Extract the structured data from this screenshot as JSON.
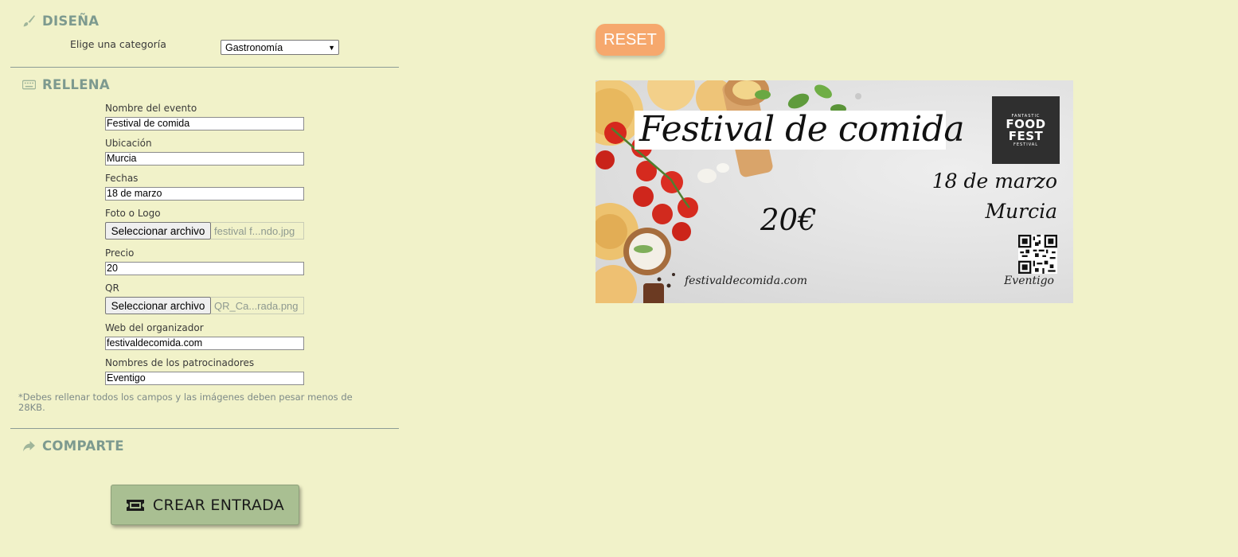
{
  "design": {
    "heading": "DISEÑA",
    "category_label": "Elige una categoría",
    "category_selected": "Gastronomía"
  },
  "fill": {
    "heading": "RELLENA",
    "fields": {
      "event_name": {
        "label": "Nombre del evento",
        "value": "Festival de comida"
      },
      "location": {
        "label": "Ubicación",
        "value": "Murcia"
      },
      "dates": {
        "label": "Fechas",
        "value": "18 de marzo"
      },
      "photo": {
        "label": "Foto o Logo",
        "button": "Seleccionar archivo",
        "filename": "festival f...ndo.jpg"
      },
      "price": {
        "label": "Precio",
        "value": "20"
      },
      "qr": {
        "label": "QR",
        "button": "Seleccionar archivo",
        "filename": "QR_Ca...rada.png"
      },
      "website": {
        "label": "Web del organizador",
        "value": "festivaldecomida.com"
      },
      "sponsors": {
        "label": "Nombres de los patrocinadores",
        "value": "Eventigo"
      }
    },
    "note": "*Debes rellenar todos los campos y las imágenes deben pesar menos de 28KB."
  },
  "share": {
    "heading": "COMPARTE",
    "create_button": "CREAR ENTRADA"
  },
  "preview": {
    "reset_label": "RESET",
    "ticket": {
      "title": "Festival de comida",
      "date": "18 de marzo",
      "location": "Murcia",
      "price": "20€",
      "website": "festivaldecomida.com",
      "sponsor": "Eventigo",
      "logo": {
        "top": "FANTASTIC",
        "main1": "FOOD",
        "main2": "FEST",
        "bottom": "FESTIVAL"
      }
    }
  },
  "colors": {
    "background": "#f1f2c9",
    "section_heading": "#7d9a8f",
    "create_button": "#a9bf92",
    "reset_button": "#f6a86d"
  },
  "icons": {
    "design": "paint-brush-icon",
    "fill": "keyboard-icon",
    "share": "share-arrow-icon",
    "create": "ticket-icon"
  }
}
